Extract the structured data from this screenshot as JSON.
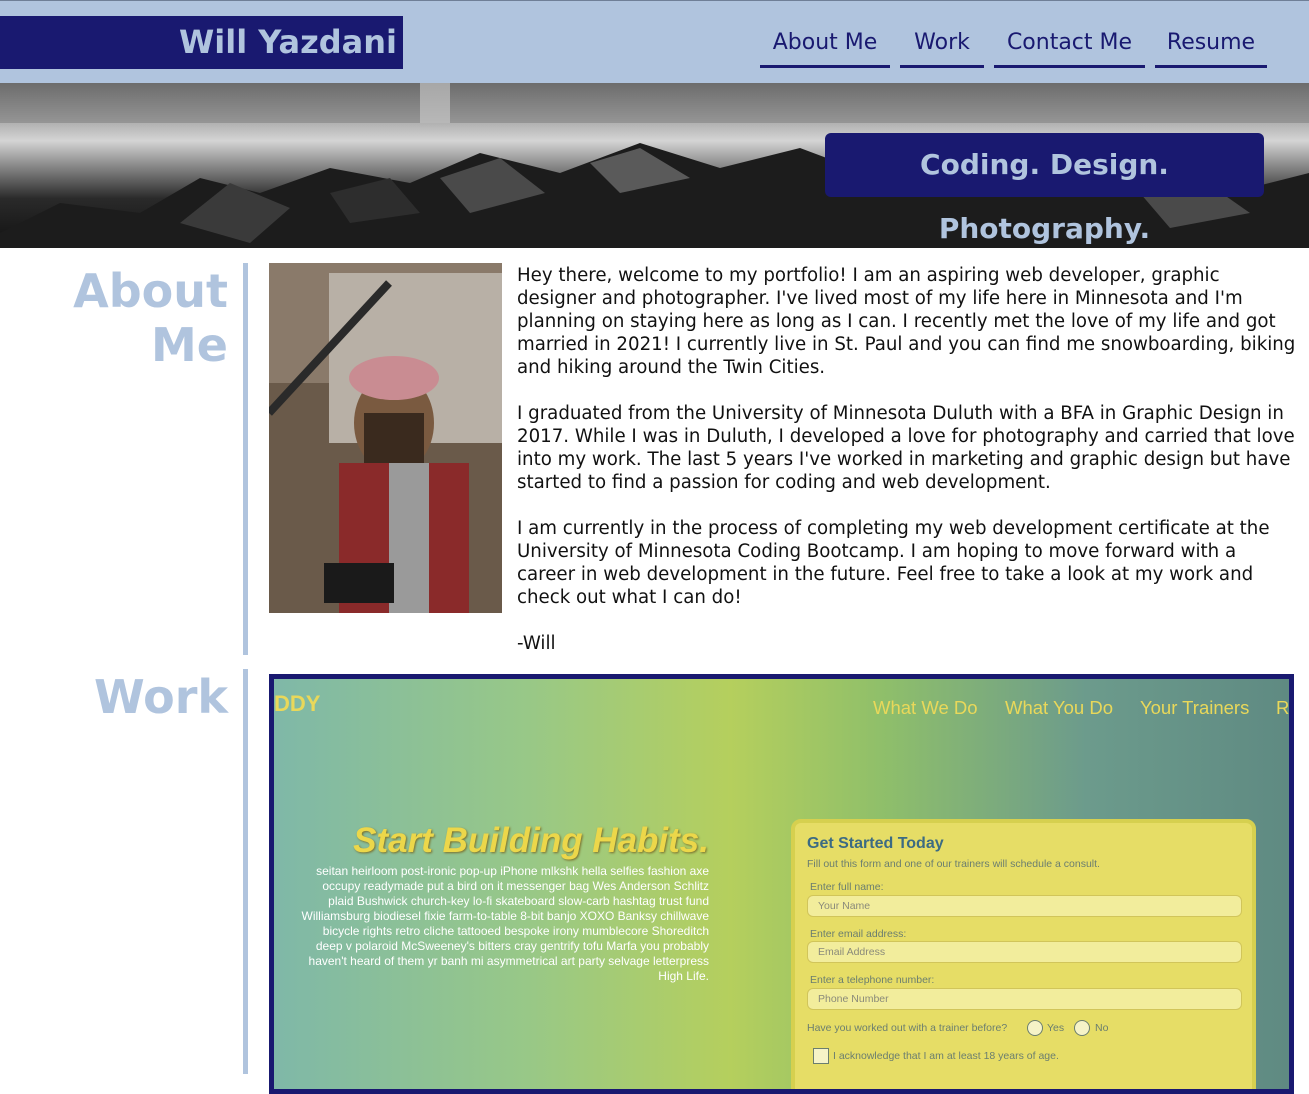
{
  "header": {
    "brand": "Will Yazdani",
    "nav": [
      "About Me",
      "Work",
      "Contact Me",
      "Resume"
    ]
  },
  "hero": {
    "tagline": "Coding. Design. Photography."
  },
  "about": {
    "title": "About Me",
    "paragraphs": [
      "Hey there, welcome to my portfolio! I am an aspiring web developer, graphic designer and photographer. I've lived most of my life here in Minnesota and I'm planning on staying here as long as I can. I recently met the love of my life and got married in 2021! I currently live in St. Paul and you can find me snowboarding, biking and hiking around the Twin Cities.",
      "I graduated from the University of Minnesota Duluth with a BFA in Graphic Design in 2017. While I was in Duluth, I developed a love for photography and carried that love into my work. The last 5 years I've worked in marketing and graphic design but have started to find a passion for coding and web development.",
      "I am currently in the process of completing my web development certificate at the University of Minnesota Coding Bootcamp. I am hoping to move forward with a career in web development in the future. Feel free to take a look at my work and check out what I can do!",
      "-Will"
    ]
  },
  "work": {
    "title": "Work",
    "preview": {
      "brand": "DDY",
      "nav": [
        "What We Do",
        "What You Do",
        "Your Trainers",
        "R"
      ],
      "headline": "Start Building Habits.",
      "body": "seitan heirloom post-ironic pop-up iPhone mlkshk hella selfies fashion axe occupy readymade put a bird on it messenger bag Wes Anderson Schlitz plaid Bushwick church-key lo-fi skateboard slow-carb hashtag trust fund Williamsburg biodiesel fixie farm-to-table 8-bit banjo XOXO Banksy chillwave bicycle rights retro cliche tattooed bespoke irony mumblecore Shoreditch deep v polaroid McSweeney's bitters cray gentrify tofu Marfa you probably haven't heard of them yr banh mi asymmetrical art party selvage letterpress High Life.",
      "form": {
        "title": "Get Started Today",
        "subtitle": "Fill out this form and one of our trainers will schedule a consult.",
        "name_label": "Enter full name:",
        "name_placeholder": "Your Name",
        "email_label": "Enter email address:",
        "email_placeholder": "Email Address",
        "phone_label": "Enter a telephone number:",
        "phone_placeholder": "Phone Number",
        "question": "Have you worked out with a trainer before?",
        "yes": "Yes",
        "no": "No",
        "ack": "I acknowledge that I am at least 18 years of age."
      }
    }
  }
}
